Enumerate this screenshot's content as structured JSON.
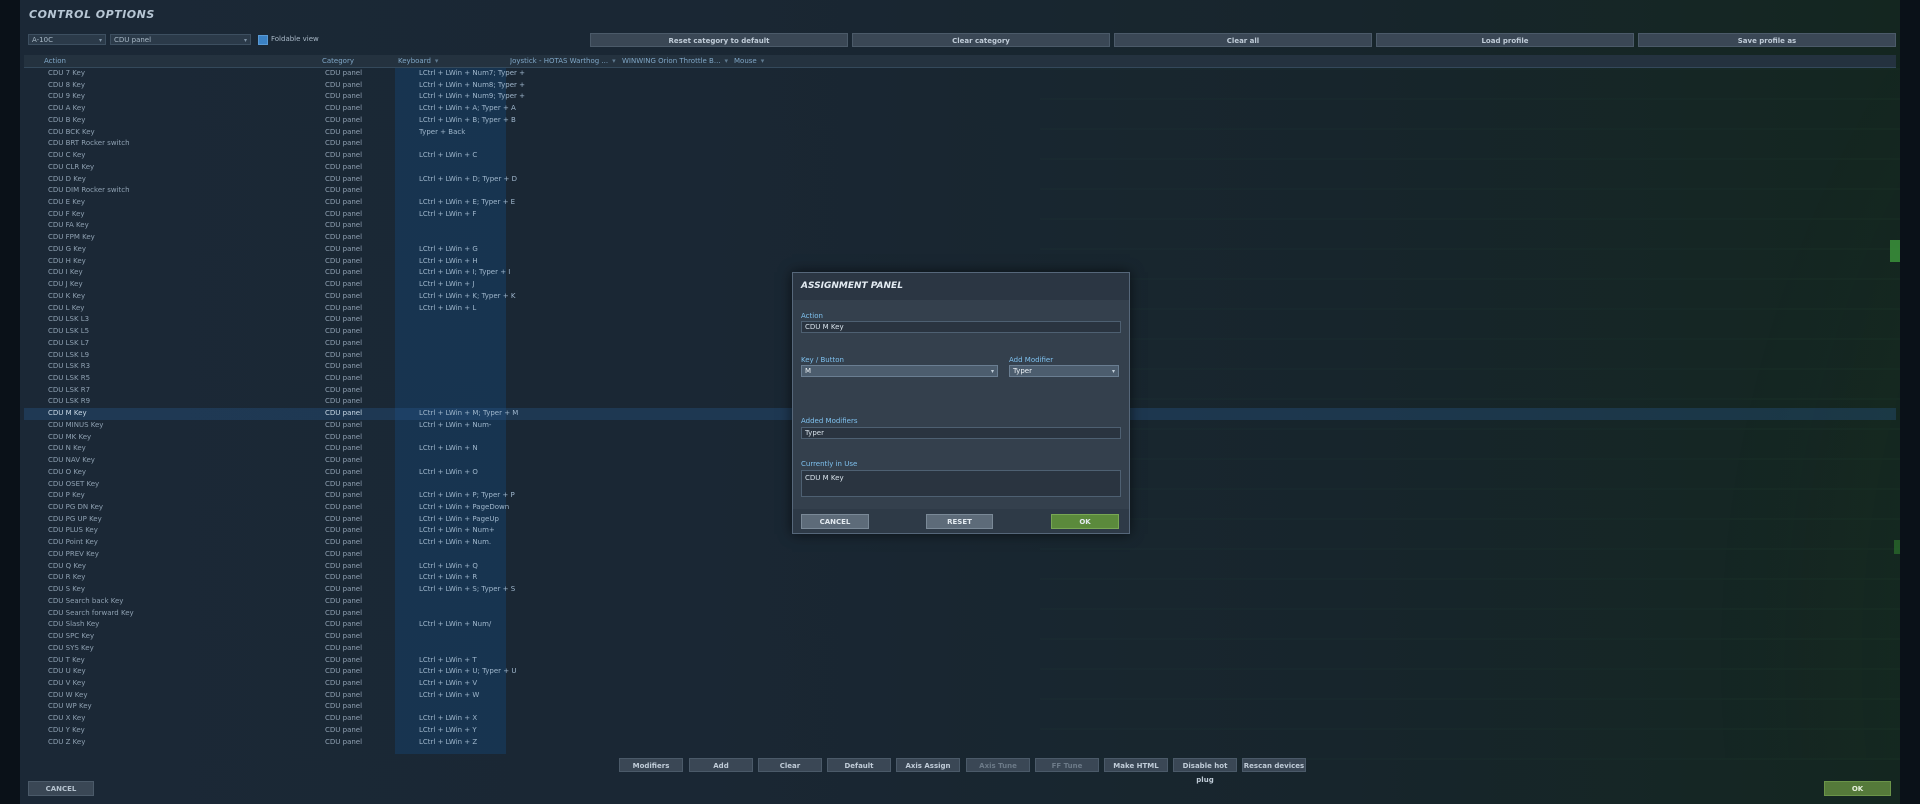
{
  "title": "CONTROL OPTIONS",
  "aircraft_select": "A-10C",
  "category_select": "CDU panel",
  "foldable_label": "Foldable view",
  "top_buttons": [
    "Reset category to default",
    "Clear category",
    "Clear all",
    "Load profile",
    "Save profile as"
  ],
  "columns": [
    "Action",
    "Category",
    "Keyboard",
    "Joystick - HOTAS Warthog ...",
    "WINWING Orion Throttle B...",
    "Mouse"
  ],
  "rows": [
    {
      "action": "CDU 7 Key",
      "category": "CDU panel",
      "keyboard": "LCtrl + LWin + Num7; Typer +"
    },
    {
      "action": "CDU 8 Key",
      "category": "CDU panel",
      "keyboard": "LCtrl + LWin + Num8; Typer +"
    },
    {
      "action": "CDU 9 Key",
      "category": "CDU panel",
      "keyboard": "LCtrl + LWin + Num9; Typer +"
    },
    {
      "action": "CDU A Key",
      "category": "CDU panel",
      "keyboard": "LCtrl + LWin + A; Typer + A"
    },
    {
      "action": "CDU B Key",
      "category": "CDU panel",
      "keyboard": "LCtrl + LWin + B; Typer + B"
    },
    {
      "action": "CDU BCK Key",
      "category": "CDU panel",
      "keyboard": "Typer + Back"
    },
    {
      "action": "CDU BRT Rocker switch",
      "category": "CDU panel",
      "keyboard": ""
    },
    {
      "action": "CDU C Key",
      "category": "CDU panel",
      "keyboard": "LCtrl + LWin + C"
    },
    {
      "action": "CDU CLR Key",
      "category": "CDU panel",
      "keyboard": ""
    },
    {
      "action": "CDU D Key",
      "category": "CDU panel",
      "keyboard": "LCtrl + LWin + D; Typer + D"
    },
    {
      "action": "CDU DIM Rocker switch",
      "category": "CDU panel",
      "keyboard": ""
    },
    {
      "action": "CDU E Key",
      "category": "CDU panel",
      "keyboard": "LCtrl + LWin + E; Typer + E"
    },
    {
      "action": "CDU F Key",
      "category": "CDU panel",
      "keyboard": "LCtrl + LWin + F"
    },
    {
      "action": "CDU FA Key",
      "category": "CDU panel",
      "keyboard": ""
    },
    {
      "action": "CDU FPM Key",
      "category": "CDU panel",
      "keyboard": ""
    },
    {
      "action": "CDU G Key",
      "category": "CDU panel",
      "keyboard": "LCtrl + LWin + G"
    },
    {
      "action": "CDU H Key",
      "category": "CDU panel",
      "keyboard": "LCtrl + LWin + H"
    },
    {
      "action": "CDU I Key",
      "category": "CDU panel",
      "keyboard": "LCtrl + LWin + I; Typer + I"
    },
    {
      "action": "CDU J Key",
      "category": "CDU panel",
      "keyboard": "LCtrl + LWin + J"
    },
    {
      "action": "CDU K Key",
      "category": "CDU panel",
      "keyboard": "LCtrl + LWin + K; Typer + K"
    },
    {
      "action": "CDU L Key",
      "category": "CDU panel",
      "keyboard": "LCtrl + LWin + L"
    },
    {
      "action": "CDU LSK L3",
      "category": "CDU panel",
      "keyboard": ""
    },
    {
      "action": "CDU LSK L5",
      "category": "CDU panel",
      "keyboard": ""
    },
    {
      "action": "CDU LSK L7",
      "category": "CDU panel",
      "keyboard": ""
    },
    {
      "action": "CDU LSK L9",
      "category": "CDU panel",
      "keyboard": ""
    },
    {
      "action": "CDU LSK R3",
      "category": "CDU panel",
      "keyboard": ""
    },
    {
      "action": "CDU LSK R5",
      "category": "CDU panel",
      "keyboard": ""
    },
    {
      "action": "CDU LSK R7",
      "category": "CDU panel",
      "keyboard": ""
    },
    {
      "action": "CDU LSK R9",
      "category": "CDU panel",
      "keyboard": ""
    },
    {
      "action": "CDU M Key",
      "category": "CDU panel",
      "keyboard": "LCtrl + LWin + M; Typer + M"
    },
    {
      "action": "CDU MINUS Key",
      "category": "CDU panel",
      "keyboard": "LCtrl + LWin + Num-"
    },
    {
      "action": "CDU MK Key",
      "category": "CDU panel",
      "keyboard": ""
    },
    {
      "action": "CDU N Key",
      "category": "CDU panel",
      "keyboard": "LCtrl + LWin + N"
    },
    {
      "action": "CDU NAV Key",
      "category": "CDU panel",
      "keyboard": ""
    },
    {
      "action": "CDU O Key",
      "category": "CDU panel",
      "keyboard": "LCtrl + LWin + O"
    },
    {
      "action": "CDU OSET Key",
      "category": "CDU panel",
      "keyboard": ""
    },
    {
      "action": "CDU P Key",
      "category": "CDU panel",
      "keyboard": "LCtrl + LWin + P; Typer + P"
    },
    {
      "action": "CDU PG DN Key",
      "category": "CDU panel",
      "keyboard": "LCtrl + LWin + PageDown"
    },
    {
      "action": "CDU PG UP Key",
      "category": "CDU panel",
      "keyboard": "LCtrl + LWin + PageUp"
    },
    {
      "action": "CDU PLUS Key",
      "category": "CDU panel",
      "keyboard": "LCtrl + LWin + Num+"
    },
    {
      "action": "CDU Point Key",
      "category": "CDU panel",
      "keyboard": "LCtrl + LWin + Num."
    },
    {
      "action": "CDU PREV Key",
      "category": "CDU panel",
      "keyboard": ""
    },
    {
      "action": "CDU Q Key",
      "category": "CDU panel",
      "keyboard": "LCtrl + LWin + Q"
    },
    {
      "action": "CDU R Key",
      "category": "CDU panel",
      "keyboard": "LCtrl + LWin + R"
    },
    {
      "action": "CDU S Key",
      "category": "CDU panel",
      "keyboard": "LCtrl + LWin + S; Typer + S"
    },
    {
      "action": "CDU Search back Key",
      "category": "CDU panel",
      "keyboard": ""
    },
    {
      "action": "CDU Search forward Key",
      "category": "CDU panel",
      "keyboard": ""
    },
    {
      "action": "CDU Slash Key",
      "category": "CDU panel",
      "keyboard": "LCtrl + LWin + Num/"
    },
    {
      "action": "CDU SPC Key",
      "category": "CDU panel",
      "keyboard": ""
    },
    {
      "action": "CDU SYS Key",
      "category": "CDU panel",
      "keyboard": ""
    },
    {
      "action": "CDU T Key",
      "category": "CDU panel",
      "keyboard": "LCtrl + LWin + T"
    },
    {
      "action": "CDU U Key",
      "category": "CDU panel",
      "keyboard": "LCtrl + LWin + U; Typer + U"
    },
    {
      "action": "CDU V Key",
      "category": "CDU panel",
      "keyboard": "LCtrl + LWin + V"
    },
    {
      "action": "CDU W Key",
      "category": "CDU panel",
      "keyboard": "LCtrl + LWin + W"
    },
    {
      "action": "CDU WP Key",
      "category": "CDU panel",
      "keyboard": ""
    },
    {
      "action": "CDU X Key",
      "category": "CDU panel",
      "keyboard": "LCtrl + LWin + X"
    },
    {
      "action": "CDU Y Key",
      "category": "CDU panel",
      "keyboard": "LCtrl + LWin + Y"
    },
    {
      "action": "CDU Z Key",
      "category": "CDU panel",
      "keyboard": "LCtrl + LWin + Z"
    }
  ],
  "selected_row_index": 29,
  "bottom_buttons": [
    "Modifiers",
    "Add",
    "Clear",
    "Default",
    "Axis Assign",
    "Axis Tune",
    "FF Tune",
    "Make HTML",
    "Disable hot plug",
    "Rescan devices"
  ],
  "bottom_buttons_dimmed": [
    false,
    false,
    false,
    false,
    false,
    true,
    true,
    false,
    false,
    false
  ],
  "cancel_label": "CANCEL",
  "ok_label": "OK",
  "modal": {
    "title": "ASSIGNMENT PANEL",
    "action_label": "Action",
    "action_value": "CDU M Key",
    "key_label": "Key / Button",
    "key_value": "M",
    "modifier_label": "Add Modifier",
    "modifier_value": "Typer",
    "added_label": "Added Modifiers",
    "added_value": "Typer",
    "inuse_label": "Currently in Use",
    "inuse_value": "CDU M Key",
    "cancel": "CANCEL",
    "reset": "RESET",
    "ok": "OK"
  },
  "icons": {
    "dropdown": "chevron-down-icon",
    "checkbox": "checkbox-icon"
  }
}
